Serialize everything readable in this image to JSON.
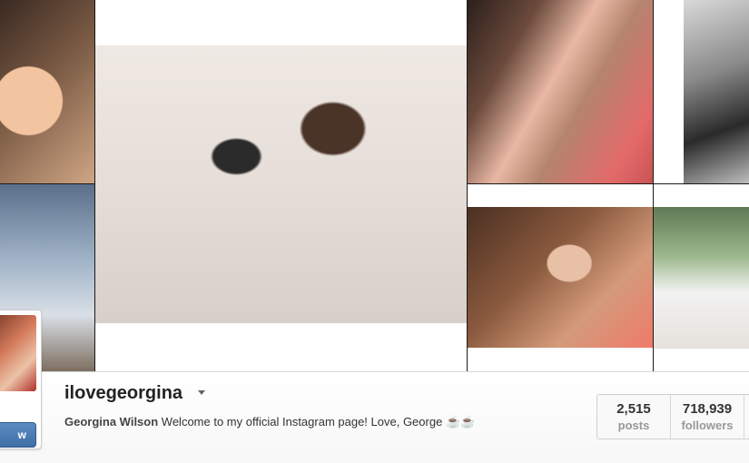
{
  "profile": {
    "username": "ilovegeorgina",
    "full_name": "Georgina Wilson",
    "bio": "Welcome to my official Instagram page! Love, George",
    "bio_emoji": "☕☕",
    "follow_label": "w"
  },
  "stats": [
    {
      "value": "2,515",
      "label": "posts"
    },
    {
      "value": "718,939",
      "label": "followers"
    }
  ],
  "icons": {
    "username_dropdown": "caret-down-icon"
  }
}
